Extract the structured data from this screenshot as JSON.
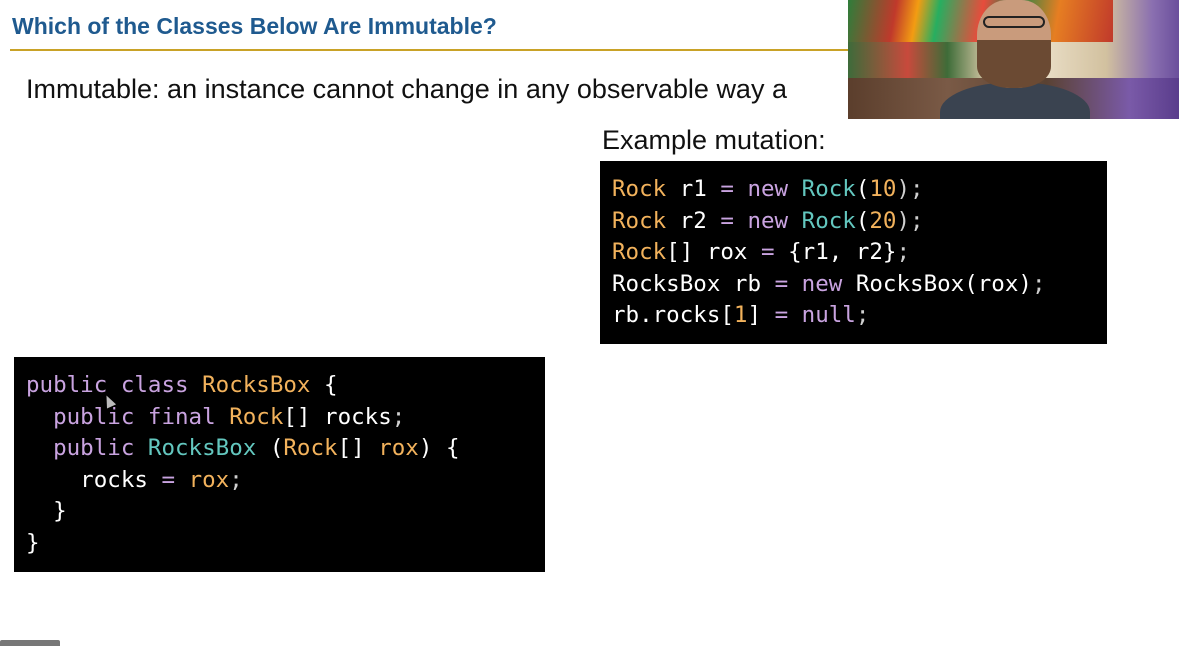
{
  "slide": {
    "title": "Which of the Classes Below Are Immutable?",
    "definition": "Immutable: an instance cannot change in any observable way a",
    "example_heading": "Example mutation:"
  },
  "mutation_code": [
    [
      {
        "t": "Rock",
        "c": "type"
      },
      {
        "t": " r1 ",
        "c": "plain"
      },
      {
        "t": "=",
        "c": "op"
      },
      {
        "t": " ",
        "c": "plain"
      },
      {
        "t": "new",
        "c": "kw"
      },
      {
        "t": " ",
        "c": "plain"
      },
      {
        "t": "Rock",
        "c": "ctor"
      },
      {
        "t": "(",
        "c": "plain"
      },
      {
        "t": "10",
        "c": "num"
      },
      {
        "t": ");",
        "c": "punct"
      }
    ],
    [
      {
        "t": "Rock",
        "c": "type"
      },
      {
        "t": " r2 ",
        "c": "plain"
      },
      {
        "t": "=",
        "c": "op"
      },
      {
        "t": " ",
        "c": "plain"
      },
      {
        "t": "new",
        "c": "kw"
      },
      {
        "t": " ",
        "c": "plain"
      },
      {
        "t": "Rock",
        "c": "ctor"
      },
      {
        "t": "(",
        "c": "plain"
      },
      {
        "t": "20",
        "c": "num"
      },
      {
        "t": ");",
        "c": "punct"
      }
    ],
    [
      {
        "t": "Rock",
        "c": "type"
      },
      {
        "t": "[] rox ",
        "c": "plain"
      },
      {
        "t": "=",
        "c": "op"
      },
      {
        "t": " {r1, r2}",
        "c": "plain"
      },
      {
        "t": ";",
        "c": "punct"
      }
    ],
    [
      {
        "t": "RocksBox rb ",
        "c": "plain"
      },
      {
        "t": "=",
        "c": "op"
      },
      {
        "t": " ",
        "c": "plain"
      },
      {
        "t": "new",
        "c": "kw"
      },
      {
        "t": " RocksBox(rox)",
        "c": "plain"
      },
      {
        "t": ";",
        "c": "punct"
      }
    ],
    [
      {
        "t": "rb.rocks[",
        "c": "plain"
      },
      {
        "t": "1",
        "c": "num"
      },
      {
        "t": "] ",
        "c": "plain"
      },
      {
        "t": "=",
        "c": "op"
      },
      {
        "t": " ",
        "c": "plain"
      },
      {
        "t": "null",
        "c": "kw"
      },
      {
        "t": ";",
        "c": "punct"
      }
    ]
  ],
  "class_code": [
    [
      {
        "t": "public",
        "c": "kw"
      },
      {
        "t": " ",
        "c": "plain"
      },
      {
        "t": "class",
        "c": "kw"
      },
      {
        "t": " ",
        "c": "plain"
      },
      {
        "t": "RocksBox",
        "c": "type"
      },
      {
        "t": " {",
        "c": "plain"
      }
    ],
    [
      {
        "t": "  ",
        "c": "plain"
      },
      {
        "t": "public",
        "c": "kw"
      },
      {
        "t": " ",
        "c": "plain"
      },
      {
        "t": "final",
        "c": "kw"
      },
      {
        "t": " ",
        "c": "plain"
      },
      {
        "t": "Rock",
        "c": "type"
      },
      {
        "t": "[] rocks",
        "c": "plain"
      },
      {
        "t": ";",
        "c": "punct"
      }
    ],
    [
      {
        "t": "  ",
        "c": "plain"
      },
      {
        "t": "public",
        "c": "kw"
      },
      {
        "t": " ",
        "c": "plain"
      },
      {
        "t": "RocksBox",
        "c": "ctor"
      },
      {
        "t": " (",
        "c": "plain"
      },
      {
        "t": "Rock",
        "c": "type"
      },
      {
        "t": "[] ",
        "c": "plain"
      },
      {
        "t": "rox",
        "c": "type"
      },
      {
        "t": ") {",
        "c": "plain"
      }
    ],
    [
      {
        "t": "    rocks ",
        "c": "plain"
      },
      {
        "t": "=",
        "c": "op"
      },
      {
        "t": " ",
        "c": "plain"
      },
      {
        "t": "rox",
        "c": "type"
      },
      {
        "t": ";",
        "c": "punct"
      }
    ],
    [
      {
        "t": "  }",
        "c": "plain"
      }
    ],
    [
      {
        "t": "}",
        "c": "plain"
      }
    ]
  ],
  "colors": {
    "title": "#1f5a8f",
    "title_rule": "#c9a227",
    "code_background": "#000000",
    "code_type": "#f2b25c",
    "code_keyword": "#c9a3e0",
    "code_constructor": "#63c7bf"
  }
}
